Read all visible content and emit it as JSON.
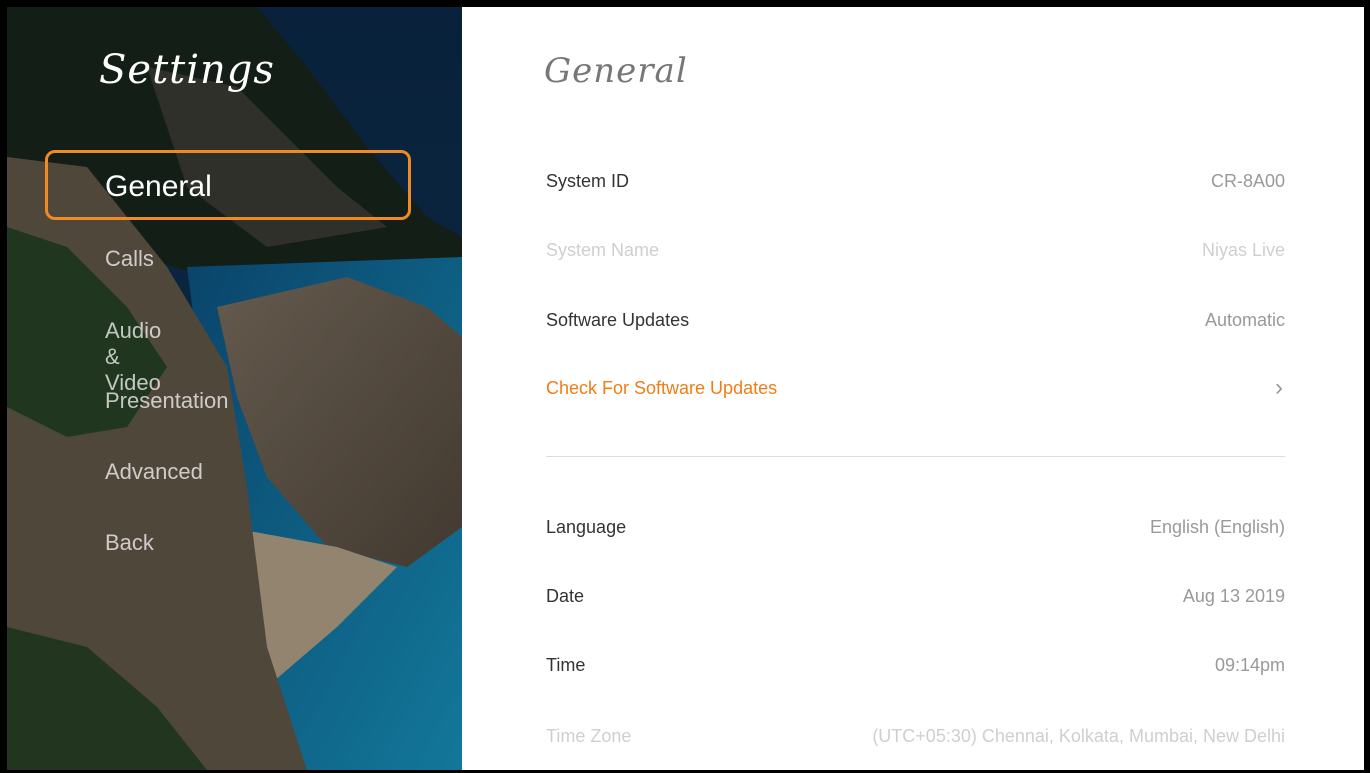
{
  "sidebar": {
    "title": "Settings",
    "items": [
      {
        "label": "General"
      },
      {
        "label": "Calls"
      },
      {
        "label": "Audio & Video"
      },
      {
        "label": "Presentation"
      },
      {
        "label": "Advanced"
      },
      {
        "label": "Back"
      }
    ]
  },
  "main": {
    "title": "General",
    "rows": [
      {
        "label": "System ID",
        "value": "CR-8A00"
      },
      {
        "label": "System Name",
        "value": "Niyas Live"
      },
      {
        "label": "Software Updates",
        "value": "Automatic"
      },
      {
        "label": "Check For Software Updates",
        "value": ""
      },
      {
        "label": "Language",
        "value": "English (English)"
      },
      {
        "label": "Date",
        "value": "Aug 13 2019"
      },
      {
        "label": "Time",
        "value": "09:14pm"
      },
      {
        "label": "Time Zone",
        "value": "(UTC+05:30) Chennai, Kolkata, Mumbai, New Delhi"
      }
    ]
  },
  "icons": {
    "chevron": "chevron-right-icon"
  },
  "colors": {
    "accent": "#f08a24",
    "link": "#ef7d16"
  }
}
